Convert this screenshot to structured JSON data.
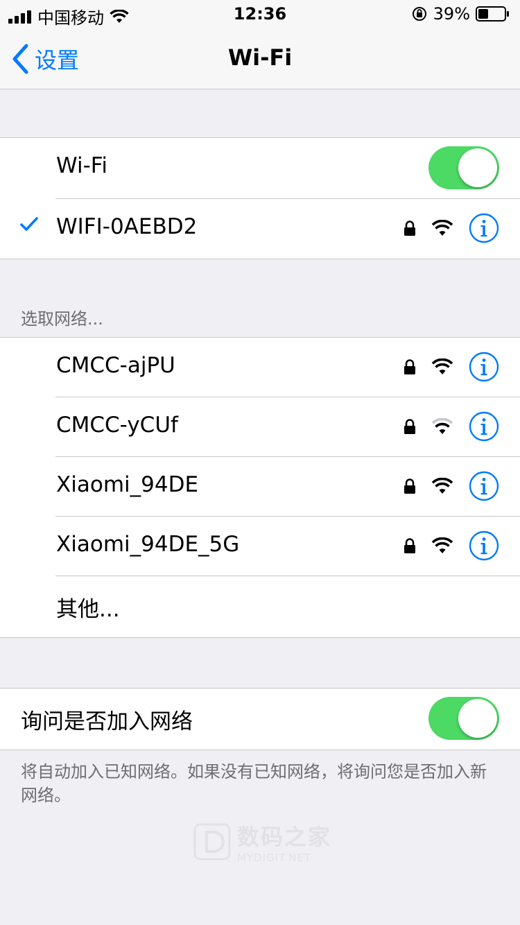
{
  "status_bar": {
    "carrier": "中国移动",
    "time": "12:36",
    "battery_percent": "39%",
    "battery_level": 0.39
  },
  "nav": {
    "back_label": "设置",
    "title": "Wi-Fi"
  },
  "wifi_group": {
    "toggle_label": "Wi-Fi",
    "wifi_enabled": true,
    "connected_network": "WIFI-0AEBD2"
  },
  "networks_section": {
    "header": "选取网络...",
    "networks": [
      {
        "name": "CMCC-ajPU",
        "secured": true,
        "signal": "full"
      },
      {
        "name": "CMCC-yCUf",
        "secured": true,
        "signal": "weak"
      },
      {
        "name": "Xiaomi_94DE",
        "secured": true,
        "signal": "full"
      },
      {
        "name": "Xiaomi_94DE_5G",
        "secured": true,
        "signal": "full"
      }
    ],
    "other_label": "其他..."
  },
  "ask_join": {
    "label": "询问是否加入网络",
    "enabled": true,
    "note": "将自动加入已知网络。如果没有已知网络，将询问您是否加入新网络。"
  },
  "watermark": {
    "title": "数码之家",
    "subtitle": "MYDIGIT.NET"
  },
  "colors": {
    "accent": "#007aff",
    "toggle_on": "#4cd964",
    "background": "#efeff4",
    "secondary_text": "#6d6d72"
  },
  "icons": {
    "lock": "lock-icon",
    "wifi": "wifi-signal-icon",
    "info": "info-icon",
    "check": "checkmark-icon",
    "back": "chevron-left-icon"
  }
}
